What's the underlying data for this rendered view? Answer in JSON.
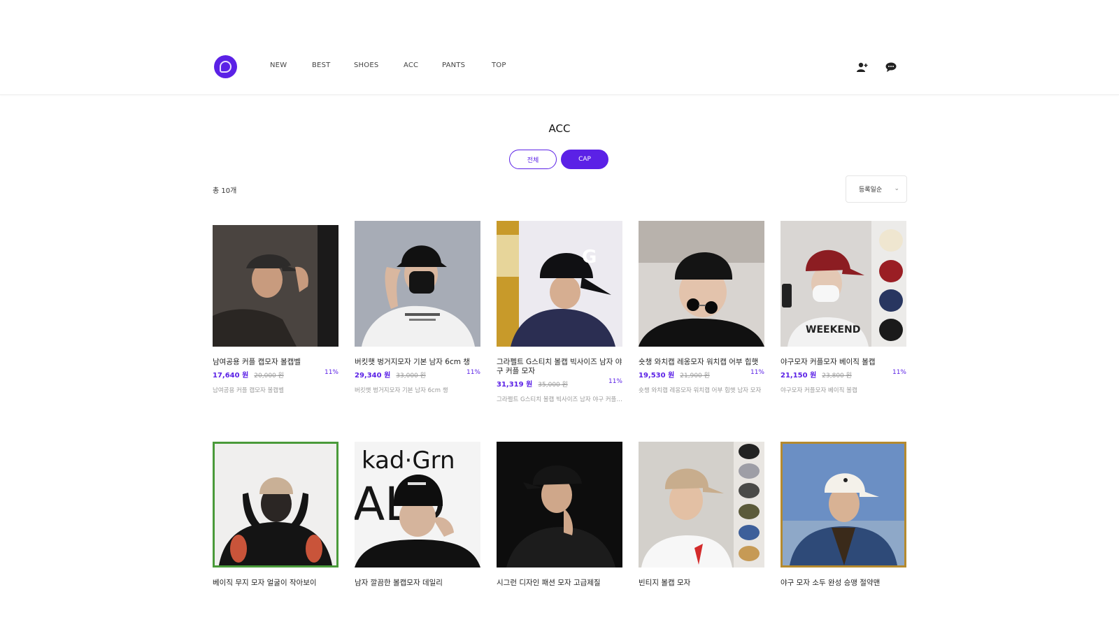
{
  "header": {
    "logo_alt": "logo",
    "nav": [
      "NEW",
      "BEST",
      "SHOES",
      "ACC",
      "PANTS",
      "TOP"
    ],
    "icons": [
      "user-add-icon",
      "chat-icon"
    ]
  },
  "category": {
    "title": "ACC",
    "filters": [
      {
        "label": "전체",
        "active": false
      },
      {
        "label": "CAP",
        "active": true
      }
    ],
    "count": "총 10개",
    "sort": "등록일순"
  },
  "products": [
    {
      "name": "남여공용 커플 캡모자 볼캡벨",
      "price": "17,640 원",
      "original": "20,000 원",
      "discount": "11%",
      "desc": "남여공용 커플 캡모자 볼캡벨"
    },
    {
      "name": "버킷햇 벙거지모자 기본 남자 6cm 챙",
      "price": "29,340 원",
      "original": "33,000 원",
      "discount": "11%",
      "desc": "버킷햇 벙거지모자 기본 남자 6cm 챙"
    },
    {
      "name": "그라펠트 G스티치 볼캡 빅사이즈 남자 야구 커플 모자",
      "price": "31,319 원",
      "original": "35,000 원",
      "discount": "11%",
      "desc": "그라펠트 G스티치 볼캡 빅사이즈 남자 야구 커플 모자"
    },
    {
      "name": "숏챙 와치캡 레옹모자 워치캡 어부 힙햇",
      "price": "19,530 원",
      "original": "21,900 원",
      "discount": "11%",
      "desc": "숏챙 와치캡 레옹모자 워치캡 어부 힙햇 남자 모자"
    },
    {
      "name": "야구모자 커플모자 베이직 볼캡",
      "price": "21,150 원",
      "original": "23,800 원",
      "discount": "11%",
      "desc": "야구모자 커플모자 베이직 볼캡"
    },
    {
      "name": "베이직 무지 모자 얼굴이 작아보이",
      "price": "",
      "original": "",
      "discount": "",
      "desc": ""
    },
    {
      "name": "남자 깔끔한 볼캡모자 데일리",
      "price": "",
      "original": "",
      "discount": "",
      "desc": ""
    },
    {
      "name": "시그런 디자인 패션 모자 고급제질",
      "price": "",
      "original": "",
      "discount": "",
      "desc": ""
    },
    {
      "name": "빈티지 볼캡 모자",
      "price": "",
      "original": "",
      "discount": "",
      "desc": ""
    },
    {
      "name": "야구 모자 소두 완성 승맹 절약맨",
      "price": "",
      "original": "",
      "discount": "",
      "desc": ""
    }
  ],
  "image_text": {
    "tshirt_print": "WEEKEND",
    "banner_top": "kad·Grn",
    "banner_big": "ALO",
    "cap_letter": "G"
  },
  "colors": {
    "accent": "#5b21e6",
    "frame_green": "#4a9a3a",
    "frame_gold": "#b58a2e"
  }
}
